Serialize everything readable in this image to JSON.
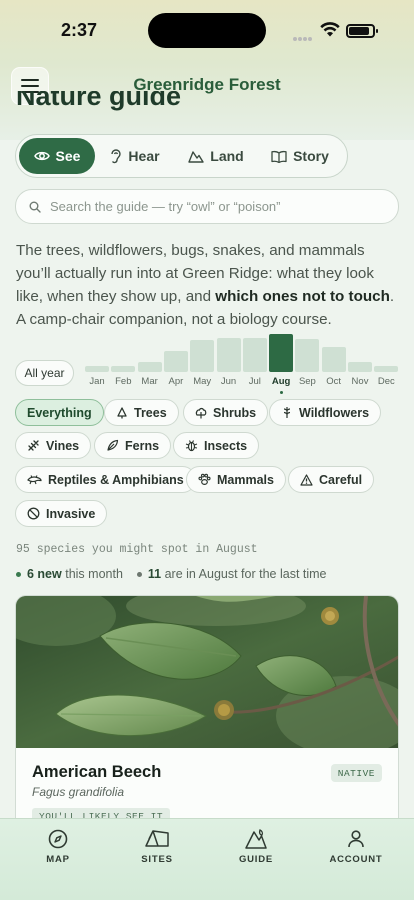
{
  "status": {
    "time": "2:37"
  },
  "header": {
    "title": "Greenridge Forest",
    "menu_icon": "hamburger-icon"
  },
  "page": {
    "heading": "Nature guide"
  },
  "modes": [
    {
      "label": "See",
      "icon": "eye-icon",
      "active": true
    },
    {
      "label": "Hear",
      "icon": "ear-icon",
      "active": false
    },
    {
      "label": "Land",
      "icon": "mountain-icon",
      "active": false
    },
    {
      "label": "Story",
      "icon": "book-icon",
      "active": false
    }
  ],
  "search": {
    "placeholder": "Search the guide — try “owl” or “poison”"
  },
  "intro": {
    "text_before": "The trees, wildflowers, bugs, snakes, and mammals you’ll actually run into at Green Ridge: what they look like, when they show up, and ",
    "emphasis": "which ones not to touch",
    "text_after": ". A camp-chair companion, not a biology course."
  },
  "season": {
    "all_year_label": "All year",
    "selected_month": "Aug",
    "months": [
      {
        "label": "Jan",
        "level": 0.17
      },
      {
        "label": "Feb",
        "level": 0.17
      },
      {
        "label": "Mar",
        "level": 0.26
      },
      {
        "label": "Apr",
        "level": 0.56
      },
      {
        "label": "May",
        "level": 0.83
      },
      {
        "label": "Jun",
        "level": 0.89
      },
      {
        "label": "Jul",
        "level": 0.89
      },
      {
        "label": "Aug",
        "level": 1.0
      },
      {
        "label": "Sep",
        "level": 0.86
      },
      {
        "label": "Oct",
        "level": 0.66
      },
      {
        "label": "Nov",
        "level": 0.26
      },
      {
        "label": "Dec",
        "level": 0.17
      }
    ]
  },
  "categories": [
    {
      "label": "Everything",
      "icon": "",
      "active": true
    },
    {
      "label": "Trees",
      "icon": "tree-icon",
      "active": false
    },
    {
      "label": "Shrubs",
      "icon": "shrub-icon",
      "active": false
    },
    {
      "label": "Wildflowers",
      "icon": "wildflower-icon",
      "active": false
    },
    {
      "label": "Vines",
      "icon": "vine-icon",
      "active": false
    },
    {
      "label": "Ferns",
      "icon": "fern-icon",
      "active": false
    },
    {
      "label": "Insects",
      "icon": "bug-icon",
      "active": false
    },
    {
      "label": "Reptiles & Amphibians",
      "icon": "reptile-icon",
      "active": false
    },
    {
      "label": "Mammals",
      "icon": "paw-icon",
      "active": false
    },
    {
      "label": "Careful",
      "icon": "warning-icon",
      "active": false
    },
    {
      "label": "Invasive",
      "icon": "prohibited-icon",
      "active": false
    }
  ],
  "summary": {
    "count_line": "95 species you might spot in August",
    "new_count": "6 new",
    "new_suffix": "this month",
    "last_count": "11",
    "last_suffix": "are in August for the last time"
  },
  "species_card": {
    "name": "American Beech",
    "latin": "Fagus grandifolia",
    "status_badge": "NATIVE",
    "likelihood_badge": "YOU'LL LIKELY SEE IT"
  },
  "tabbar": [
    {
      "label": "MAP",
      "icon": "compass-icon"
    },
    {
      "label": "SITES",
      "icon": "tent-icon"
    },
    {
      "label": "GUIDE",
      "icon": "guide-icon"
    },
    {
      "label": "ACCOUNT",
      "icon": "person-icon"
    }
  ]
}
